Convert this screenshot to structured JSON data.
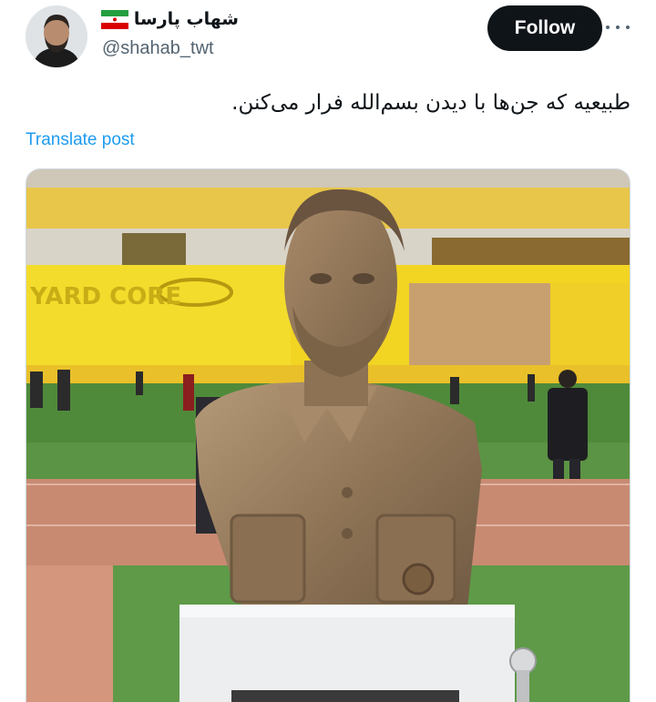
{
  "tweet": {
    "author": {
      "display_name": "شهاب پارسا",
      "handle": "@shahab_twt",
      "flag_icon": "iran-flag-icon",
      "avatar_icon": "user-avatar"
    },
    "follow_label": "Follow",
    "more_icon": "more-options-icon",
    "text": "طبیعیه که جن‌ها با دیدن بسم‌الله فرار می‌کنن.",
    "translate_label": "Translate post",
    "media": {
      "description_icon": "bust-statue-photo",
      "stadium_banner_text": "YARD CORE"
    }
  },
  "colors": {
    "follow_bg": "#0f1419",
    "link": "#1d9bf0",
    "handle": "#536471",
    "stadium_yellow": "#f2d423",
    "pitch_green": "#4f8a3a",
    "track": "#c98a72",
    "bronze": "#9a7d5e"
  }
}
